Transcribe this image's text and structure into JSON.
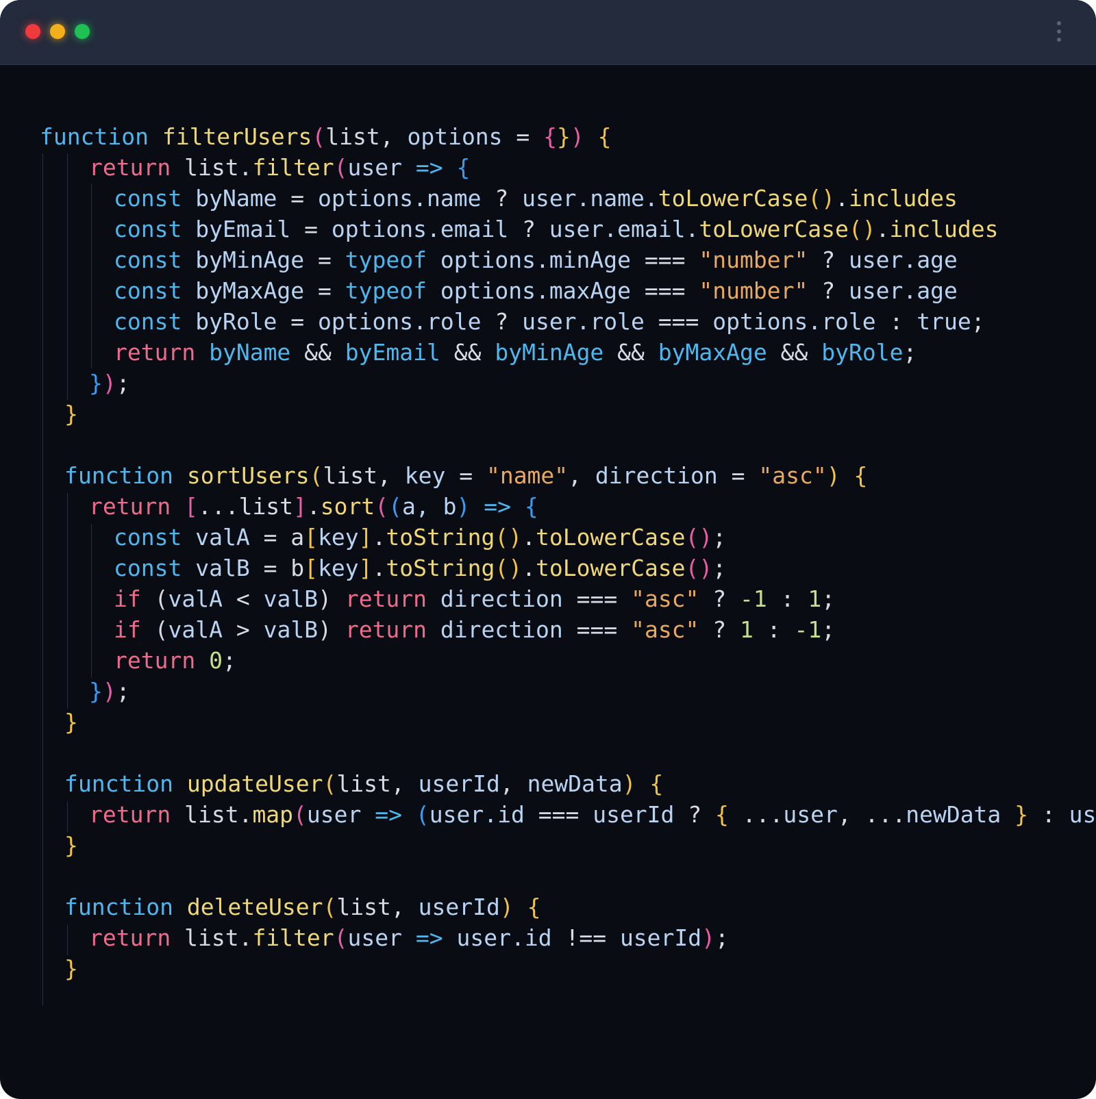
{
  "window": {
    "controls": [
      "close",
      "minimize",
      "maximize"
    ],
    "menu_icon": "kebab-menu-icon"
  },
  "colors": {
    "background": "#0a0c14",
    "titlebar": "#232b3c",
    "keyword": "#ef6b8b",
    "declaration": "#4fb7ee",
    "function_name": "#f0d878",
    "identifier": "#b9d4f2",
    "string": "#e9a860",
    "number": "#c6e08a",
    "operator": "#e4e8ef",
    "bracket_yellow": "#f0c34a",
    "bracket_pink": "#e760a6",
    "bracket_blue": "#3e9cf0",
    "plain": "#d6dbe6"
  },
  "code": {
    "language": "javascript",
    "lines": [
      {
        "indent": 0,
        "tokens": [
          [
            "declaration",
            "function"
          ],
          [
            "plain",
            " "
          ],
          [
            "function_name",
            "filterUsers"
          ],
          [
            "bracket_pink",
            "("
          ],
          [
            "plain",
            "list, "
          ],
          [
            "identifier",
            "options"
          ],
          [
            "plain",
            " = "
          ],
          [
            "bracket_pink",
            "{"
          ],
          [
            "bracket_yellow",
            "}"
          ],
          [
            "bracket_pink",
            ")"
          ],
          [
            "plain",
            " "
          ],
          [
            "bracket_yellow",
            "{"
          ]
        ]
      },
      {
        "indent": 2,
        "tokens": [
          [
            "keyword",
            "return"
          ],
          [
            "plain",
            " list."
          ],
          [
            "function_name",
            "filter"
          ],
          [
            "bracket_pink",
            "("
          ],
          [
            "identifier",
            "user"
          ],
          [
            "plain",
            " "
          ],
          [
            "declaration",
            "=>"
          ],
          [
            "plain",
            " "
          ],
          [
            "bracket_blue",
            "{"
          ]
        ]
      },
      {
        "indent": 3,
        "tokens": [
          [
            "declaration",
            "const"
          ],
          [
            "plain",
            " "
          ],
          [
            "identifier",
            "byName"
          ],
          [
            "plain",
            " = "
          ],
          [
            "identifier",
            "options.name"
          ],
          [
            "plain",
            " ? "
          ],
          [
            "identifier",
            "user.name."
          ],
          [
            "function_name",
            "toLowerCase"
          ],
          [
            "bracket_yellow",
            "()"
          ],
          [
            "plain",
            "."
          ],
          [
            "function_name",
            "includes"
          ]
        ]
      },
      {
        "indent": 3,
        "tokens": [
          [
            "declaration",
            "const"
          ],
          [
            "plain",
            " "
          ],
          [
            "identifier",
            "byEmail"
          ],
          [
            "plain",
            " = "
          ],
          [
            "identifier",
            "options.email"
          ],
          [
            "plain",
            " ? "
          ],
          [
            "identifier",
            "user.email."
          ],
          [
            "function_name",
            "toLowerCase"
          ],
          [
            "bracket_yellow",
            "()"
          ],
          [
            "plain",
            "."
          ],
          [
            "function_name",
            "includes"
          ]
        ]
      },
      {
        "indent": 3,
        "tokens": [
          [
            "declaration",
            "const"
          ],
          [
            "plain",
            " "
          ],
          [
            "identifier",
            "byMinAge"
          ],
          [
            "plain",
            " = "
          ],
          [
            "declaration",
            "typeof"
          ],
          [
            "plain",
            " "
          ],
          [
            "identifier",
            "options.minAge"
          ],
          [
            "plain",
            " === "
          ],
          [
            "string",
            "\"number\""
          ],
          [
            "plain",
            " ? "
          ],
          [
            "identifier",
            "user.age"
          ]
        ]
      },
      {
        "indent": 3,
        "tokens": [
          [
            "declaration",
            "const"
          ],
          [
            "plain",
            " "
          ],
          [
            "identifier",
            "byMaxAge"
          ],
          [
            "plain",
            " = "
          ],
          [
            "declaration",
            "typeof"
          ],
          [
            "plain",
            " "
          ],
          [
            "identifier",
            "options.maxAge"
          ],
          [
            "plain",
            " === "
          ],
          [
            "string",
            "\"number\""
          ],
          [
            "plain",
            " ? "
          ],
          [
            "identifier",
            "user.age"
          ]
        ]
      },
      {
        "indent": 3,
        "tokens": [
          [
            "declaration",
            "const"
          ],
          [
            "plain",
            " "
          ],
          [
            "identifier",
            "byRole"
          ],
          [
            "plain",
            " = "
          ],
          [
            "identifier",
            "options.role"
          ],
          [
            "plain",
            " ? "
          ],
          [
            "identifier",
            "user.role"
          ],
          [
            "plain",
            " === "
          ],
          [
            "identifier",
            "options.role"
          ],
          [
            "plain",
            " : "
          ],
          [
            "identifier",
            "true"
          ],
          [
            "plain",
            ";"
          ]
        ]
      },
      {
        "indent": 3,
        "tokens": [
          [
            "keyword",
            "return"
          ],
          [
            "plain",
            " "
          ],
          [
            "declaration",
            "byName"
          ],
          [
            "plain",
            " && "
          ],
          [
            "declaration",
            "byEmail"
          ],
          [
            "plain",
            " && "
          ],
          [
            "declaration",
            "byMinAge"
          ],
          [
            "plain",
            " && "
          ],
          [
            "declaration",
            "byMaxAge"
          ],
          [
            "plain",
            " && "
          ],
          [
            "declaration",
            "byRole"
          ],
          [
            "plain",
            ";"
          ]
        ]
      },
      {
        "indent": 2,
        "tokens": [
          [
            "bracket_blue",
            "}"
          ],
          [
            "bracket_pink",
            ")"
          ],
          [
            "plain",
            ";"
          ]
        ]
      },
      {
        "indent": 1,
        "tokens": [
          [
            "bracket_yellow",
            "}"
          ]
        ]
      },
      {
        "indent": 1,
        "tokens": []
      },
      {
        "indent": 1,
        "tokens": [
          [
            "declaration",
            "function"
          ],
          [
            "plain",
            " "
          ],
          [
            "function_name",
            "sortUsers"
          ],
          [
            "bracket_yellow",
            "("
          ],
          [
            "plain",
            "list, "
          ],
          [
            "identifier",
            "key"
          ],
          [
            "plain",
            " = "
          ],
          [
            "string",
            "\"name\""
          ],
          [
            "plain",
            ", "
          ],
          [
            "identifier",
            "direction"
          ],
          [
            "plain",
            " = "
          ],
          [
            "string",
            "\"asc\""
          ],
          [
            "bracket_yellow",
            ")"
          ],
          [
            "plain",
            " "
          ],
          [
            "bracket_yellow",
            "{"
          ]
        ]
      },
      {
        "indent": 2,
        "tokens": [
          [
            "keyword",
            "return"
          ],
          [
            "plain",
            " "
          ],
          [
            "bracket_pink",
            "["
          ],
          [
            "plain",
            "...list"
          ],
          [
            "bracket_pink",
            "]"
          ],
          [
            "plain",
            "."
          ],
          [
            "function_name",
            "sort"
          ],
          [
            "bracket_pink",
            "("
          ],
          [
            "bracket_blue",
            "("
          ],
          [
            "identifier",
            "a, b"
          ],
          [
            "bracket_blue",
            ")"
          ],
          [
            "plain",
            " "
          ],
          [
            "declaration",
            "=>"
          ],
          [
            "plain",
            " "
          ],
          [
            "bracket_blue",
            "{"
          ]
        ]
      },
      {
        "indent": 3,
        "tokens": [
          [
            "declaration",
            "const"
          ],
          [
            "plain",
            " "
          ],
          [
            "identifier",
            "valA"
          ],
          [
            "plain",
            " = a"
          ],
          [
            "bracket_yellow",
            "["
          ],
          [
            "identifier",
            "key"
          ],
          [
            "bracket_yellow",
            "]"
          ],
          [
            "plain",
            "."
          ],
          [
            "function_name",
            "toString"
          ],
          [
            "bracket_yellow",
            "()"
          ],
          [
            "plain",
            "."
          ],
          [
            "function_name",
            "toLowerCase"
          ],
          [
            "bracket_pink",
            "()"
          ],
          [
            "plain",
            ";"
          ]
        ]
      },
      {
        "indent": 3,
        "tokens": [
          [
            "declaration",
            "const"
          ],
          [
            "plain",
            " "
          ],
          [
            "identifier",
            "valB"
          ],
          [
            "plain",
            " = b"
          ],
          [
            "bracket_yellow",
            "["
          ],
          [
            "identifier",
            "key"
          ],
          [
            "bracket_yellow",
            "]"
          ],
          [
            "plain",
            "."
          ],
          [
            "function_name",
            "toString"
          ],
          [
            "bracket_yellow",
            "()"
          ],
          [
            "plain",
            "."
          ],
          [
            "function_name",
            "toLowerCase"
          ],
          [
            "bracket_pink",
            "()"
          ],
          [
            "plain",
            ";"
          ]
        ]
      },
      {
        "indent": 3,
        "tokens": [
          [
            "keyword",
            "if"
          ],
          [
            "plain",
            " ("
          ],
          [
            "identifier",
            "valA"
          ],
          [
            "plain",
            " < "
          ],
          [
            "identifier",
            "valB"
          ],
          [
            "plain",
            ") "
          ],
          [
            "keyword",
            "return"
          ],
          [
            "plain",
            " "
          ],
          [
            "identifier",
            "direction"
          ],
          [
            "plain",
            " === "
          ],
          [
            "string",
            "\"asc\""
          ],
          [
            "plain",
            " ? "
          ],
          [
            "number",
            "-1"
          ],
          [
            "plain",
            " : "
          ],
          [
            "number",
            "1"
          ],
          [
            "plain",
            ";"
          ]
        ]
      },
      {
        "indent": 3,
        "tokens": [
          [
            "keyword",
            "if"
          ],
          [
            "plain",
            " ("
          ],
          [
            "identifier",
            "valA"
          ],
          [
            "plain",
            " > "
          ],
          [
            "identifier",
            "valB"
          ],
          [
            "plain",
            ") "
          ],
          [
            "keyword",
            "return"
          ],
          [
            "plain",
            " "
          ],
          [
            "identifier",
            "direction"
          ],
          [
            "plain",
            " === "
          ],
          [
            "string",
            "\"asc\""
          ],
          [
            "plain",
            " ? "
          ],
          [
            "number",
            "1"
          ],
          [
            "plain",
            " : "
          ],
          [
            "number",
            "-1"
          ],
          [
            "plain",
            ";"
          ]
        ]
      },
      {
        "indent": 3,
        "tokens": [
          [
            "keyword",
            "return"
          ],
          [
            "plain",
            " "
          ],
          [
            "number",
            "0"
          ],
          [
            "plain",
            ";"
          ]
        ]
      },
      {
        "indent": 2,
        "tokens": [
          [
            "bracket_blue",
            "}"
          ],
          [
            "bracket_pink",
            ")"
          ],
          [
            "plain",
            ";"
          ]
        ]
      },
      {
        "indent": 1,
        "tokens": [
          [
            "bracket_yellow",
            "}"
          ]
        ]
      },
      {
        "indent": 1,
        "tokens": []
      },
      {
        "indent": 1,
        "tokens": [
          [
            "declaration",
            "function"
          ],
          [
            "plain",
            " "
          ],
          [
            "function_name",
            "updateUser"
          ],
          [
            "bracket_yellow",
            "("
          ],
          [
            "plain",
            "list, "
          ],
          [
            "identifier",
            "userId"
          ],
          [
            "plain",
            ", "
          ],
          [
            "identifier",
            "newData"
          ],
          [
            "bracket_yellow",
            ")"
          ],
          [
            "plain",
            " "
          ],
          [
            "bracket_yellow",
            "{"
          ]
        ]
      },
      {
        "indent": 2,
        "tokens": [
          [
            "keyword",
            "return"
          ],
          [
            "plain",
            " list."
          ],
          [
            "function_name",
            "map"
          ],
          [
            "bracket_pink",
            "("
          ],
          [
            "identifier",
            "user"
          ],
          [
            "plain",
            " "
          ],
          [
            "declaration",
            "=>"
          ],
          [
            "plain",
            " "
          ],
          [
            "bracket_blue",
            "("
          ],
          [
            "identifier",
            "user.id"
          ],
          [
            "plain",
            " === "
          ],
          [
            "identifier",
            "userId"
          ],
          [
            "plain",
            " ? "
          ],
          [
            "bracket_yellow",
            "{"
          ],
          [
            "plain",
            " ..."
          ],
          [
            "identifier",
            "user"
          ],
          [
            "plain",
            ", ..."
          ],
          [
            "identifier",
            "newData"
          ],
          [
            "plain",
            " "
          ],
          [
            "bracket_yellow",
            "}"
          ],
          [
            "plain",
            " : "
          ],
          [
            "identifier",
            "user"
          ],
          [
            "bracket_blue",
            ")"
          ],
          [
            "bracket_pink",
            ")"
          ],
          [
            "plain",
            ";"
          ]
        ]
      },
      {
        "indent": 1,
        "tokens": [
          [
            "bracket_yellow",
            "}"
          ]
        ]
      },
      {
        "indent": 1,
        "tokens": []
      },
      {
        "indent": 1,
        "tokens": [
          [
            "declaration",
            "function"
          ],
          [
            "plain",
            " "
          ],
          [
            "function_name",
            "deleteUser"
          ],
          [
            "bracket_yellow",
            "("
          ],
          [
            "plain",
            "list, "
          ],
          [
            "identifier",
            "userId"
          ],
          [
            "bracket_yellow",
            ")"
          ],
          [
            "plain",
            " "
          ],
          [
            "bracket_yellow",
            "{"
          ]
        ]
      },
      {
        "indent": 2,
        "tokens": [
          [
            "keyword",
            "return"
          ],
          [
            "plain",
            " list."
          ],
          [
            "function_name",
            "filter"
          ],
          [
            "bracket_pink",
            "("
          ],
          [
            "identifier",
            "user"
          ],
          [
            "plain",
            " "
          ],
          [
            "declaration",
            "=>"
          ],
          [
            "plain",
            " "
          ],
          [
            "identifier",
            "user.id"
          ],
          [
            "plain",
            " !== "
          ],
          [
            "identifier",
            "userId"
          ],
          [
            "bracket_pink",
            ")"
          ],
          [
            "plain",
            ";"
          ]
        ]
      },
      {
        "indent": 1,
        "tokens": [
          [
            "bracket_yellow",
            "}"
          ]
        ]
      }
    ]
  }
}
